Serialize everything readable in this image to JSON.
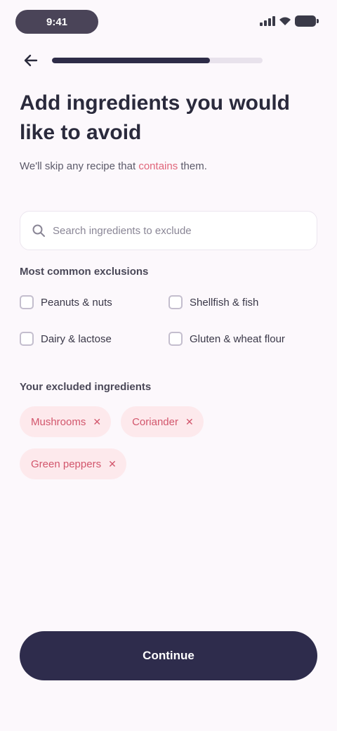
{
  "status_bar": {
    "time": "9:41"
  },
  "header": {
    "back_icon": "arrow-left-icon",
    "progress": 0.75
  },
  "page": {
    "title": "Add ingredients you would like to avoid",
    "subtitle_prefix": "We'll skip any recipe that ",
    "subtitle_accent": "contains",
    "subtitle_suffix": " them."
  },
  "search": {
    "placeholder": "Search ingredients to exclude",
    "value": ""
  },
  "popular": {
    "label": "Most common exclusions",
    "options": [
      {
        "label": "Peanuts & nuts",
        "checked": false
      },
      {
        "label": "Shellfish & fish",
        "checked": false
      },
      {
        "label": "Dairy & lactose",
        "checked": false
      },
      {
        "label": "Gluten & wheat flour",
        "checked": false
      }
    ]
  },
  "selected": {
    "label": "Your excluded ingredients",
    "chips": [
      {
        "label": "Mushrooms"
      },
      {
        "label": "Coriander"
      },
      {
        "label": "Green peppers"
      }
    ]
  },
  "footer": {
    "continue_label": "Continue"
  },
  "colors": {
    "accent": "#e0657a",
    "primary": "#2e2c4c",
    "chip_bg": "#fde9ec",
    "background": "#fcf8fc"
  }
}
